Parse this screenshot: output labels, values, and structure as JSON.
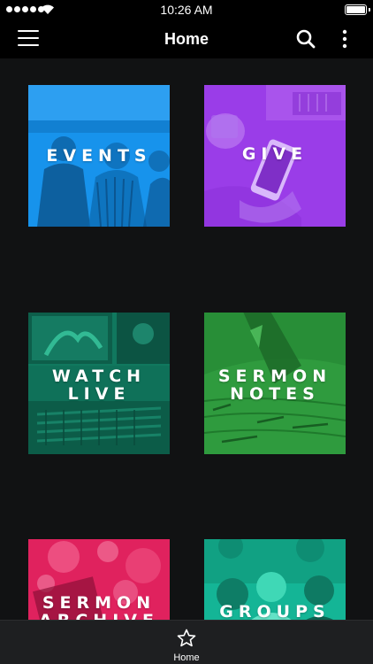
{
  "status_bar": {
    "time": "10:26 AM"
  },
  "nav": {
    "title": "Home"
  },
  "tiles": [
    {
      "label": "EVENTS",
      "color": "#1793ec"
    },
    {
      "label": "GIVE",
      "color": "#9a3de8"
    },
    {
      "label": "WATCH\nLIVE",
      "color": "#10785e"
    },
    {
      "label": "SERMON\nNOTES",
      "color": "#2f9b3e"
    },
    {
      "label": "SERMON\nARCHIVE",
      "color": "#e0225e"
    },
    {
      "label": "GROUPS",
      "color": "#14b596"
    }
  ],
  "tab_bar": {
    "home_label": "Home"
  },
  "icons": [
    "signal-icon",
    "wifi-icon",
    "battery-icon",
    "menu-icon",
    "search-icon",
    "more-icon",
    "star-icon"
  ]
}
